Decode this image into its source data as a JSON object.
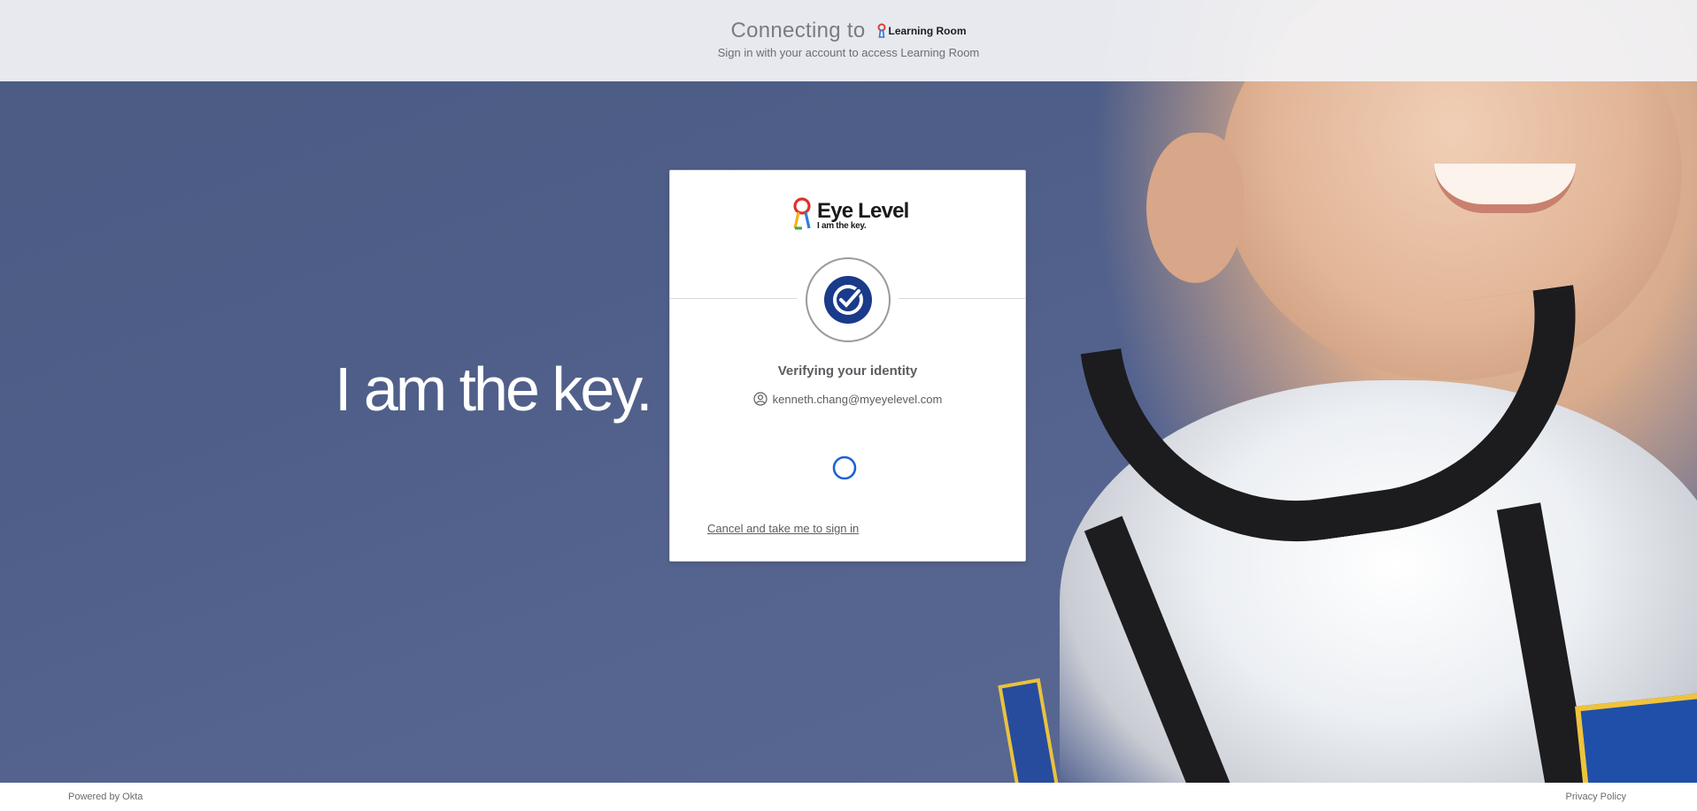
{
  "header": {
    "connecting_text": "Connecting to",
    "app_logo_text": "Learning Room",
    "subtitle": "Sign in with your account to access Learning Room"
  },
  "hero": {
    "tagline": "I am the key."
  },
  "card": {
    "brand_name": "Eye Level",
    "brand_tagline": "I am the key.",
    "factor_icon": "okta-verify-check-icon",
    "title": "Verifying your identity",
    "username": "kenneth.chang@myeyelevel.com",
    "cancel_link": "Cancel and take me to sign in"
  },
  "footer": {
    "powered_by": "Powered by Okta",
    "privacy_policy": "Privacy Policy"
  },
  "colors": {
    "factor_blue": "#1a3a8a",
    "spinner_blue": "#1d62d6",
    "background": "#4e5e88"
  }
}
